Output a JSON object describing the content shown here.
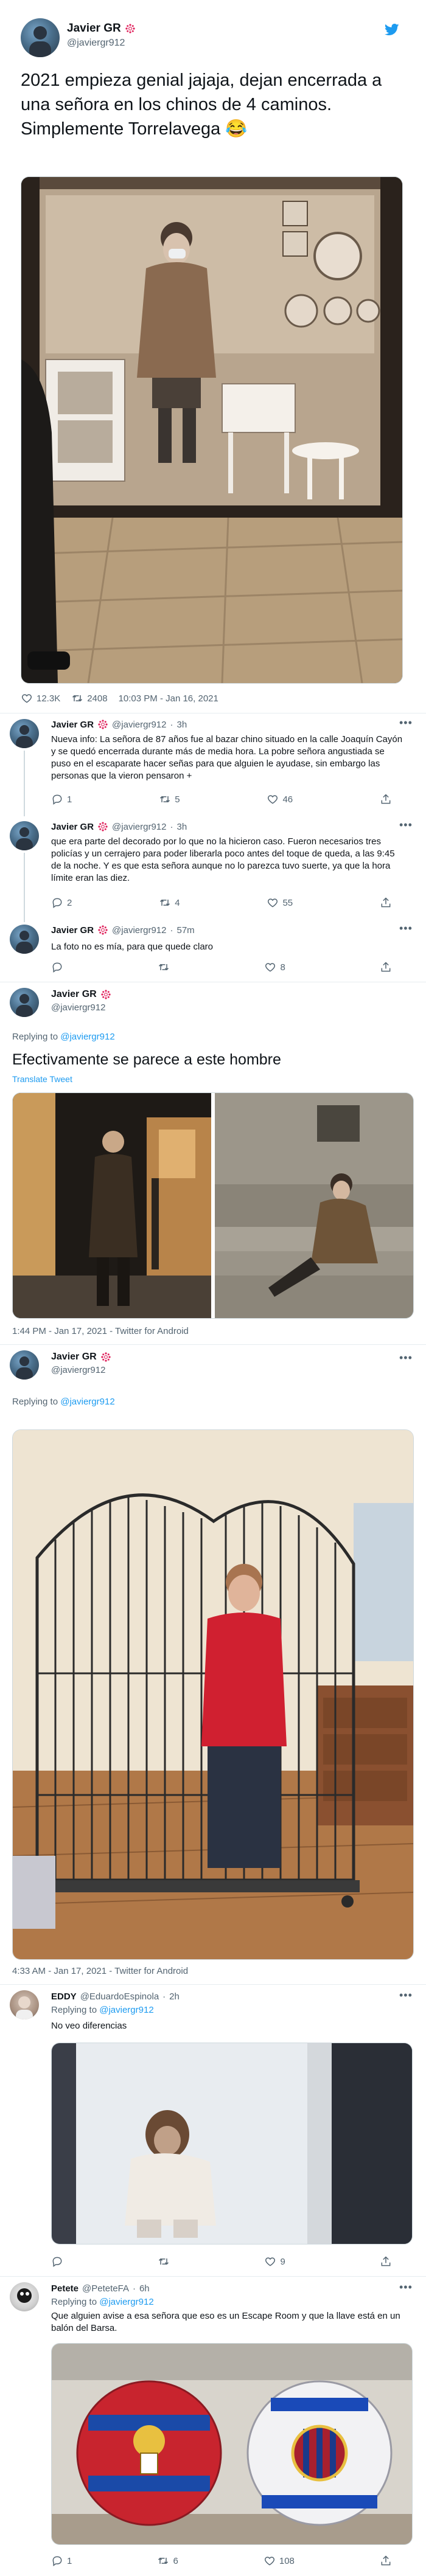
{
  "main_tweet": {
    "name": "Javier GR",
    "handle": "@javiergr912",
    "text": "2021 empieza genial jajaja, dejan encerrada a una señora en los chinos de 4 caminos. Simplemente Torrelavega 😂",
    "likes": "12.3K",
    "retweets": "2408",
    "timestamp": "10:03 PM - Jan 16, 2021"
  },
  "reply1": {
    "name": "Javier GR",
    "handle": "@javiergr912",
    "time": "3h",
    "text": "Nueva info: La señora de 87 años fue al bazar chino situado en la calle Joaquín Cayón y se quedó encerrada durante más de media hora. La pobre señora angustiada se puso en el escaparate hacer señas para que alguien le ayudase, sin embargo las personas que la vieron pensaron +",
    "replies": "1",
    "retweets": "5",
    "likes": "46"
  },
  "reply2": {
    "name": "Javier GR",
    "handle": "@javiergr912",
    "time": "3h",
    "text": "que era parte del decorado por lo que no la hicieron caso. Fueron necesarios tres policías y un cerrajero para poder liberarla poco antes del toque de queda, a las 9:45 de la noche. Y es que esta señora aunque no lo parezca tuvo suerte, ya que la hora límite eran las diez.",
    "replies": "2",
    "retweets": "4",
    "likes": "55"
  },
  "reply3": {
    "name": "Javier GR",
    "handle": "@javiergr912",
    "time": "57m",
    "text": "La foto no es mía, para que quede claro",
    "likes": "8"
  },
  "quote1": {
    "name": "Javier GR",
    "handle": "@javiergr912",
    "replying_prefix": "Replying to",
    "replying_to": "@javiergr912",
    "text": "Efectivamente se parece a este hombre",
    "translate": "Translate Tweet",
    "timestamp": "1:44 PM - Jan 17, 2021 - Twitter for Android"
  },
  "quote2": {
    "name": "Javier GR",
    "handle": "@javiergr912",
    "replying_prefix": "Replying to",
    "replying_to": "@javiergr912",
    "timestamp": "4:33 AM - Jan 17, 2021 - Twitter for Android"
  },
  "reply_eddy": {
    "name": "EDDY",
    "handle": "@EduardoEspinola",
    "time": "2h",
    "replying_prefix": "Replying to",
    "replying_to": "@javiergr912",
    "text": "No veo diferencias",
    "likes": "9"
  },
  "reply_petete": {
    "name": "Petete",
    "handle": "@PeteteFA",
    "time": "6h",
    "replying_prefix": "Replying to",
    "replying_to": "@javiergr912",
    "text": "Que alguien avise a esa señora que eso es un Escape Room y que la llave está en un balón del Barsa.",
    "replies": "1",
    "retweets": "6",
    "likes": "108"
  },
  "icons": {
    "badge": "verified-flower-badge-icon",
    "twitter": "twitter-bird-icon",
    "reply": "reply-icon",
    "retweet": "retweet-icon",
    "like": "heart-icon",
    "share": "share-icon",
    "more": "more-dots-icon"
  },
  "colors": {
    "accent": "#1d9bf0",
    "muted": "#536471",
    "like_active": "#f91880"
  }
}
